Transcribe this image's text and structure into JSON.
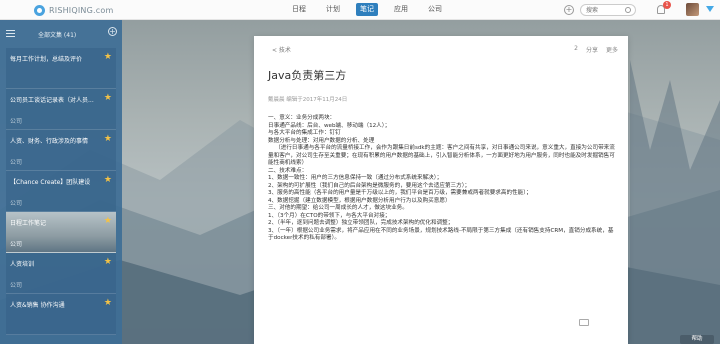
{
  "app": {
    "logo_text": "RISHIQING.com"
  },
  "nav": {
    "items": [
      "日程",
      "计划",
      "笔记",
      "应用",
      "公司"
    ],
    "active_index": 2
  },
  "search": {
    "placeholder": "搜索"
  },
  "notifications": {
    "count": "1"
  },
  "sidebar": {
    "title": "全部文集 (41)",
    "notes": [
      {
        "title": "每月工作计划，总结及评价",
        "category": "",
        "starred": true
      },
      {
        "title": "公司员工谈话记录表（对人员...",
        "category": "公司",
        "starred": true
      },
      {
        "title": "人资、财务、行政涉及的事情",
        "category": "公司",
        "starred": true
      },
      {
        "title": "【Chance Create】团队建设",
        "category": "公司",
        "starred": true
      },
      {
        "title": "日程工作笔记",
        "category": "公司",
        "starred": true
      },
      {
        "title": "人资培训",
        "category": "公司",
        "starred": true
      },
      {
        "title": "人资&销售 协作沟通",
        "category": "",
        "starred": true
      }
    ]
  },
  "editor": {
    "back_label": "< 技术",
    "actions": [
      "2",
      "分享",
      "更多"
    ],
    "title": "Java负责第三方",
    "meta": "戴晨晨 编辑于2017年11月24日",
    "body": [
      "一、意义：业务分成两块：",
      "日事通产品线：后台、web端、移动端（12人）；",
      "与各大平台的集成工作：钉钉",
      "数据分析与处理：对用户数据的分析、处理",
      "    （进行日事通与各平台的流量桥接工作，会作为跟集日前sdk的主题：客户之间有共享，对日事通公司来说，意义重大，直接为公司带来流量和客户，对公司生存至关重要；在现有积累的用户数据的基础上，引入智能分析体系，一方面更好地为用户服务，同时也能及时发掘销售可能性商机线索）",
      "",
      "二、技术难点：",
      "1、数据一致性：用户的三方信息保持一致（通过分布式系统来解决）；",
      "2、架构的可扩展性（我们自己的后台架构是微服务的，要用这个去适应第三方）；",
      "3、服务的高性能（各平台的用户量是千万级以上的，我们平台是百万级，需要兼或两者就要求高的性能）；",
      "4、数据挖掘（建立数据模型，根据用户数据分析用户行为以及购买意愿）",
      "",
      "三、对他的期望：给公司一周成长的人才，做这块业务。",
      "1、（3个月）在CTO的带领下，与各大平台对接；",
      "2、（半年，逐到问题去调整）独立带领团队，完成技术架构的优化和调整；",
      "3、（一年）根据公司业务需求，将产品应用在不同的业务场景，规划技术路线-不局限于第三方集成（还有销售支持CRM，直销分成系统，基于docker技术的私有部署）。"
    ]
  },
  "help": {
    "label": "帮助"
  }
}
